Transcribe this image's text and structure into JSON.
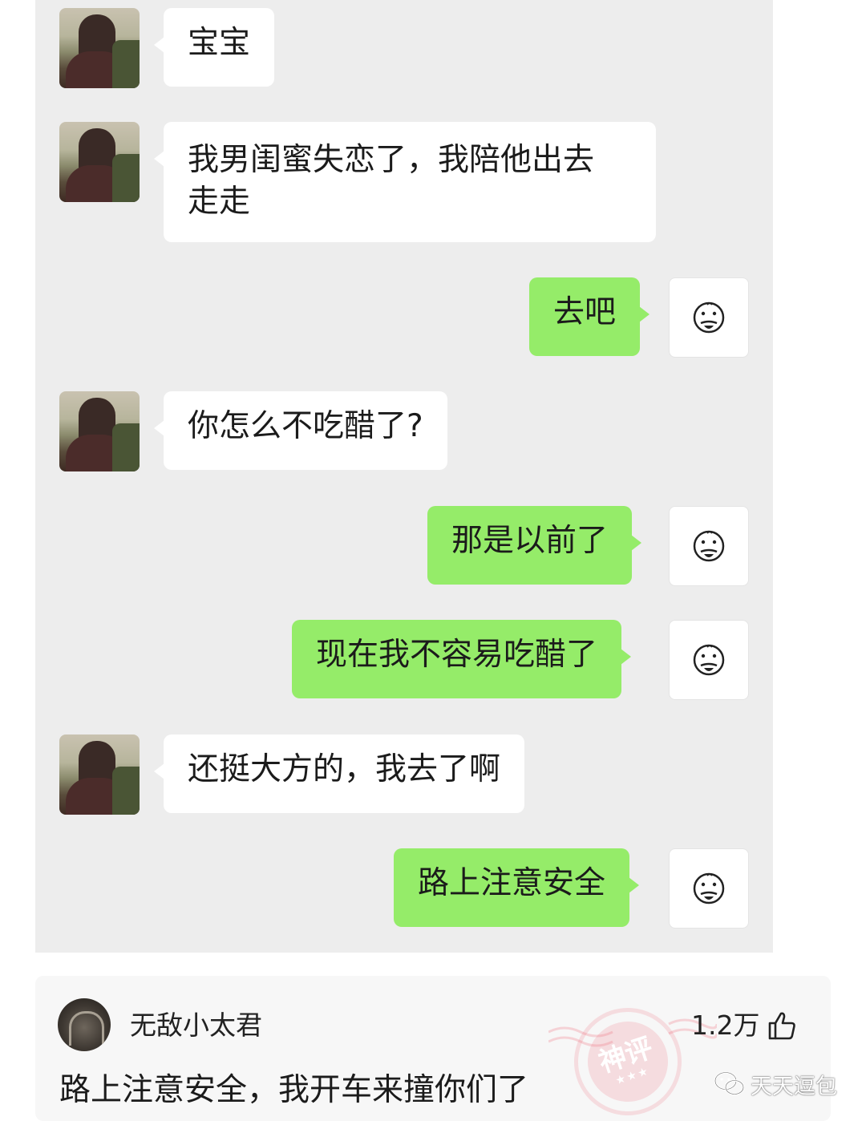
{
  "chat": {
    "messages": [
      {
        "side": "in",
        "text": "宝宝"
      },
      {
        "side": "in",
        "text": "我男闺蜜失恋了，我陪他出去",
        "text2": "走走"
      },
      {
        "side": "out",
        "text": "去吧"
      },
      {
        "side": "in",
        "text": "你怎么不吃醋了?"
      },
      {
        "side": "out",
        "text": "那是以前了"
      },
      {
        "side": "out",
        "text": "现在我不容易吃醋了"
      },
      {
        "side": "in",
        "text": "还挺大方的，我去了啊"
      },
      {
        "side": "out",
        "text": "路上注意安全"
      }
    ]
  },
  "comment": {
    "username": "无敌小太君",
    "likes": "1.2万",
    "text": "路上注意安全，我开车来撞你们了",
    "stamp_label": "神评",
    "stamp_stars": "★★★"
  },
  "watermark": {
    "text": "天天逗包"
  },
  "colors": {
    "chat_background": "#ededed",
    "incoming_bubble": "#ffffff",
    "outgoing_bubble": "#95ec69",
    "stamp": "#ee6272"
  },
  "icons": {
    "her_avatar": "photo-avatar",
    "my_avatar": "doodle-face-icon",
    "like": "thumbs-up-icon",
    "watermark": "wechat-logo-icon"
  }
}
